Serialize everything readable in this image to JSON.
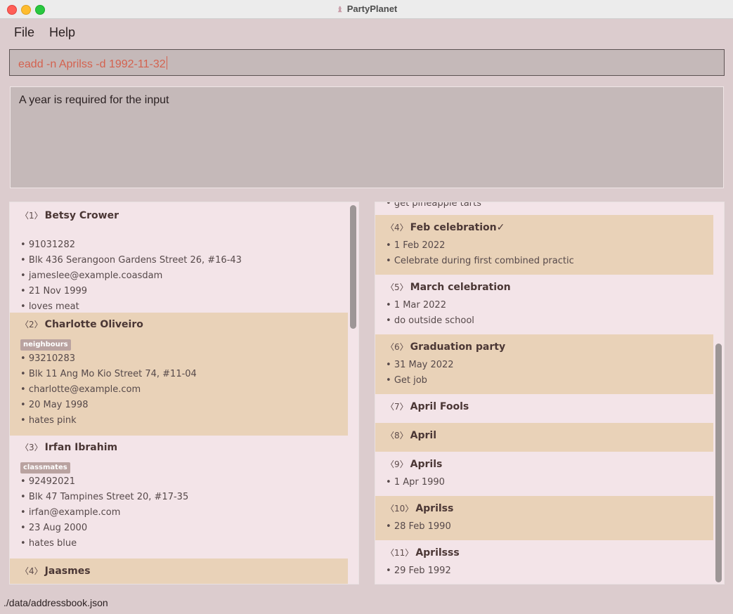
{
  "window": {
    "title": "PartyPlanet"
  },
  "menu": {
    "file": "File",
    "help": "Help"
  },
  "command": {
    "value": "eadd -n Aprilss -d 1992-11-32"
  },
  "result": {
    "text": "A year is required for the input"
  },
  "persons": [
    {
      "index": "1",
      "name": "Betsy Crower",
      "tag": "",
      "phone": "91031282",
      "address": "Blk 436 Serangoon Gardens Street 26, #16-43",
      "email": "jameslee@example.coasdam",
      "birthday": "21 Nov 1999",
      "remark": "loves meat"
    },
    {
      "index": "2",
      "name": "Charlotte Oliveiro",
      "tag": "neighbours",
      "phone": "93210283",
      "address": "Blk 11 Ang Mo Kio Street 74, #11-04",
      "email": "charlotte@example.com",
      "birthday": "20 May 1998",
      "remark": "hates pink"
    },
    {
      "index": "3",
      "name": "Irfan Ibrahim",
      "tag": "classmates",
      "phone": "92492021",
      "address": "Blk 47 Tampines Street 20, #17-35",
      "email": "irfan@example.com",
      "birthday": "23 Aug 2000",
      "remark": "hates blue"
    },
    {
      "index": "4",
      "name": "Jaasmes"
    }
  ],
  "events": {
    "partial_top": "get pineapple tarts",
    "items": [
      {
        "index": "4",
        "name": "Feb celebration",
        "done_mark": "✓",
        "date": "1 Feb 2022",
        "remark": "Celebrate during first combined practic"
      },
      {
        "index": "5",
        "name": "March celebration",
        "date": "1 Mar 2022",
        "remark": "do outside school"
      },
      {
        "index": "6",
        "name": "Graduation party",
        "date": "31 May 2022",
        "remark": "Get job"
      },
      {
        "index": "7",
        "name": "April Fools"
      },
      {
        "index": "8",
        "name": "April"
      },
      {
        "index": "9",
        "name": "Aprils",
        "date": "1 Apr 1990"
      },
      {
        "index": "10",
        "name": "Aprilss",
        "date": "28 Feb 1990"
      },
      {
        "index": "11",
        "name": "Aprilsss",
        "date": "29 Feb 1992"
      }
    ]
  },
  "status": {
    "path": "./data/addressbook.json"
  }
}
